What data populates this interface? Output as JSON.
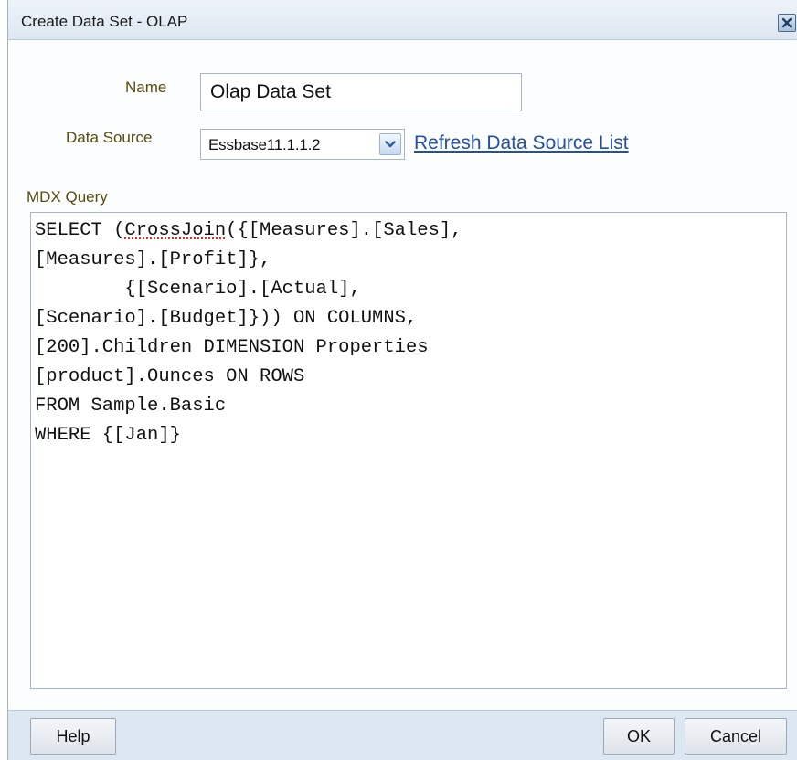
{
  "dialog": {
    "title": "Create Data Set - OLAP",
    "close_icon": "close-icon"
  },
  "form": {
    "name_label": "Name",
    "name_value": "Olap Data Set",
    "data_source_label": "Data Source",
    "data_source_value": "Essbase11.1.1.2",
    "refresh_link": "Refresh Data Source List",
    "mdx_label": "MDX Query",
    "mdx_lines": [
      "SELECT (CrossJoin({[Measures].[Sales],",
      "[Measures].[Profit]},",
      "        {[Scenario].[Actual],",
      "[Scenario].[Budget]})) ON COLUMNS,",
      "[200].Children DIMENSION Properties",
      "[product].Ounces ON ROWS",
      "FROM Sample.Basic",
      "WHERE {[Jan]}"
    ],
    "mdx_prefix": "SELECT (",
    "mdx_misspelled": "CrossJoin",
    "mdx_rest": "({[Measures].[Sales],\n[Measures].[Profit]},\n        {[Scenario].[Actual],\n[Scenario].[Budget]})) ON COLUMNS,\n[200].Children DIMENSION Properties\n[product].Ounces ON ROWS\nFROM Sample.Basic\nWHERE {[Jan]}"
  },
  "footer": {
    "help_label": "Help",
    "ok_label": "OK",
    "cancel_label": "Cancel"
  },
  "colors": {
    "label_text": "#5a4a10",
    "link": "#2450a0",
    "titlebar": "#dde7f1",
    "border": "#a7b7c8"
  }
}
